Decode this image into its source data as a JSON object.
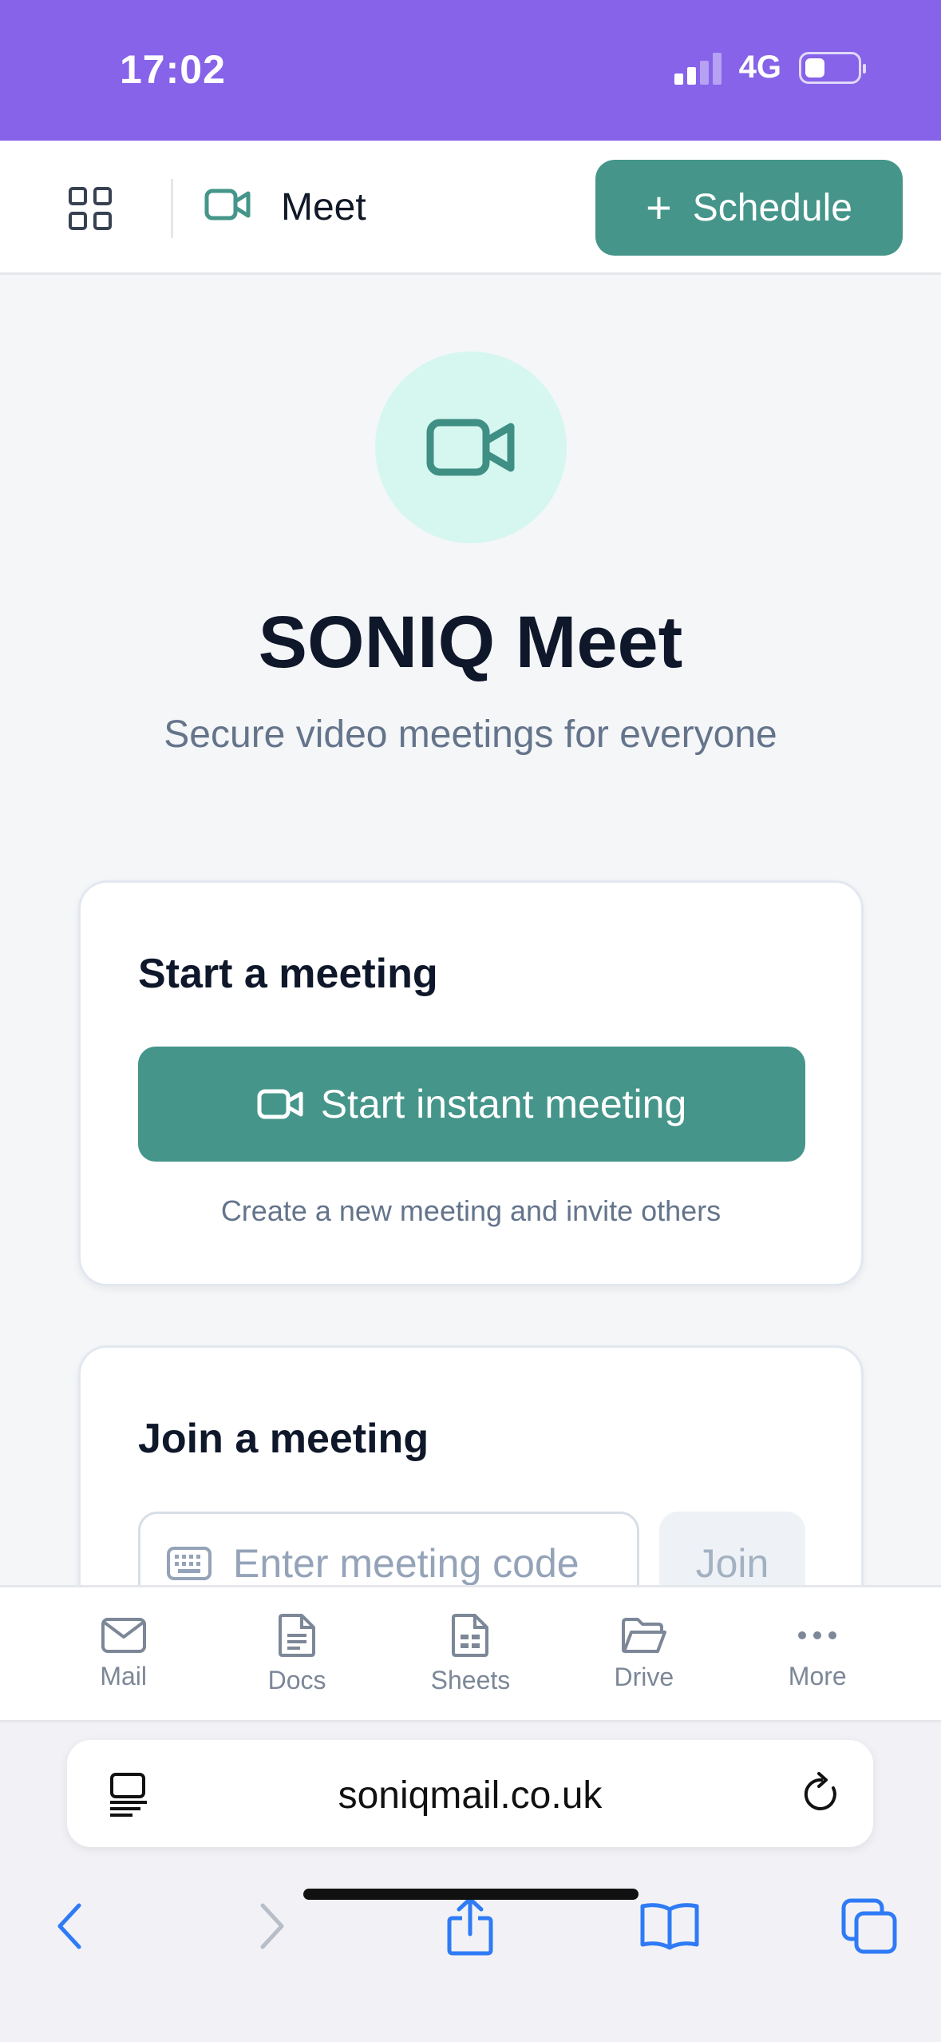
{
  "status_bar": {
    "time": "17:02",
    "network": "4G"
  },
  "header": {
    "title": "Meet",
    "schedule_label": "Schedule"
  },
  "hero": {
    "title": "SONIQ Meet",
    "subtitle": "Secure video meetings for everyone"
  },
  "start_card": {
    "title": "Start a meeting",
    "button_label": "Start instant meeting",
    "hint": "Create a new meeting and invite others"
  },
  "join_card": {
    "title": "Join a meeting",
    "input_placeholder": "Enter meeting code",
    "join_label": "Join"
  },
  "bottom_nav": {
    "items": [
      {
        "label": "Mail",
        "icon": "mail-icon"
      },
      {
        "label": "Docs",
        "icon": "docs-icon"
      },
      {
        "label": "Sheets",
        "icon": "sheets-icon"
      },
      {
        "label": "Drive",
        "icon": "drive-icon"
      },
      {
        "label": "More",
        "icon": "more-icon"
      }
    ]
  },
  "browser": {
    "url": "soniqmail.co.uk"
  },
  "colors": {
    "status_bar": "#8663e9",
    "accent": "#45958a",
    "hero_circle": "#d6f7ef"
  }
}
